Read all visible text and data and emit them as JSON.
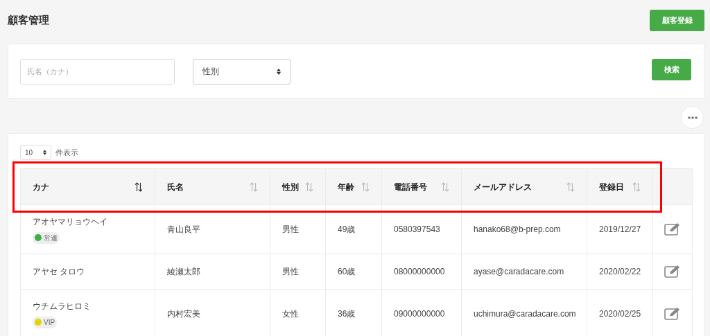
{
  "page_title": "顧客管理",
  "register_button": "顧客登録",
  "search": {
    "name_placeholder": "氏名（カナ）",
    "gender_select": "性別",
    "search_button": "検索"
  },
  "page_size": {
    "value": "10",
    "label": "件表示"
  },
  "table": {
    "columns": [
      {
        "label": "カナ",
        "sorted": true
      },
      {
        "label": "氏名",
        "sorted": false
      },
      {
        "label": "性別",
        "sorted": false
      },
      {
        "label": "年齢",
        "sorted": false
      },
      {
        "label": "電話番号",
        "sorted": false
      },
      {
        "label": "メールアドレス",
        "sorted": false
      },
      {
        "label": "登録日",
        "sorted": false
      }
    ],
    "rows": [
      {
        "kana": "アオヤマリョウヘイ",
        "tag": {
          "label": "常連",
          "color": "#3cb043"
        },
        "name": "青山良平",
        "gender": "男性",
        "age": "49歳",
        "phone": "0580397543",
        "email": "hanako68@b-prep.com",
        "registered": "2019/12/27"
      },
      {
        "kana": "アヤセ タロウ",
        "name": "綾瀬太郎",
        "gender": "男性",
        "age": "60歳",
        "phone": "08000000000",
        "email": "ayase@caradacare.com",
        "registered": "2020/02/22"
      },
      {
        "kana": "ウチムラヒロミ",
        "tag": {
          "label": "VIP",
          "color": "#e6d600"
        },
        "name": "内村宏美",
        "gender": "女性",
        "age": "36歳",
        "phone": "09000000000",
        "email": "uchimura@caradacare.com",
        "registered": "2020/02/25"
      }
    ]
  },
  "annotation": {
    "kind": "highlight"
  }
}
